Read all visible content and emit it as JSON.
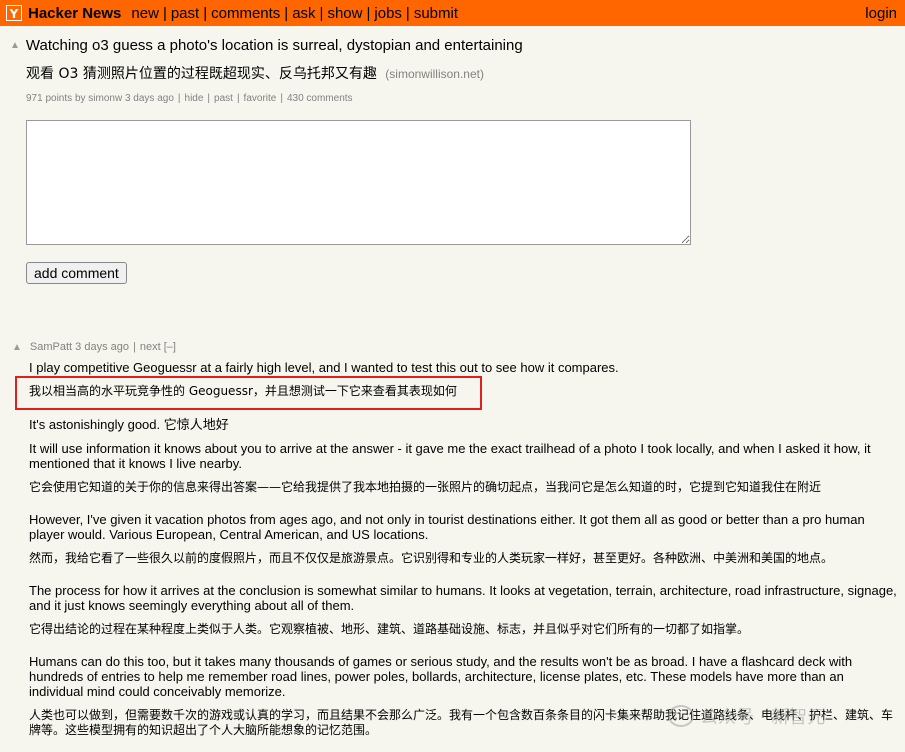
{
  "header": {
    "logo": "Y",
    "site_name": "Hacker News",
    "nav": [
      "new",
      "past",
      "comments",
      "ask",
      "show",
      "jobs",
      "submit"
    ],
    "login": "login"
  },
  "story": {
    "title": "Watching o3 guess a photo's location is surreal, dystopian and entertaining",
    "title_zh": "观看 O3 猜测照片位置的过程既超现实、反乌托邦又有趣",
    "site": "(simonwillison.net)",
    "points": "971 points",
    "by_prefix": "by",
    "author": "simonw",
    "age": "3 days ago",
    "hide": "hide",
    "past": "past",
    "favorite": "favorite",
    "comments": "430 comments"
  },
  "reply": {
    "button_label": "add comment"
  },
  "comment": {
    "author": "SamPatt",
    "age": "3 days ago",
    "next": "next",
    "toggle": "[–]",
    "paragraphs": [
      "I play competitive Geoguessr at a fairly high level, and I wanted to test this out to see how it compares.",
      "我以相当高的水平玩竞争性的 Geoguessr，并且想测试一下它来查看其表现如何",
      "It's astonishingly good.  它惊人地好",
      "It will use information it knows about you to arrive at the answer - it gave me the exact trailhead of a photo I took locally, and when I asked it how, it mentioned that it knows I live nearby.",
      "它会使用它知道的关于你的信息来得出答案——它给我提供了我本地拍摄的一张照片的确切起点，当我问它是怎么知道的时，它提到它知道我住在附近",
      "However, I've given it vacation photos from ages ago, and not only in tourist destinations either. It got them all as good or better than a pro human player would. Various European, Central American, and US locations.",
      "然而，我给它看了一些很久以前的度假照片，而且不仅仅是旅游景点。它识别得和专业的人类玩家一样好，甚至更好。各种欧洲、中美洲和美国的地点。",
      "The process for how it arrives at the conclusion is somewhat similar to humans. It looks at vegetation, terrain, architecture, road infrastructure, signage, and it just knows seemingly everything about all of them.",
      "它得出结论的过程在某种程度上类似于人类。它观察植被、地形、建筑、道路基础设施、标志，并且似乎对它们所有的一切都了如指掌。",
      "Humans can do this too, but it takes many thousands of games or serious study, and the results won't be as broad. I have a flashcard deck with hundreds of entries to help me remember road lines, power poles, bollards, architecture, license plates, etc. These models have more than an individual mind could conceivably memorize.",
      "人类也可以做到，但需要数千次的游戏或认真的学习，而且结果不会那么广泛。我有一个包含数百条条目的闪卡集来帮助我记住道路线条、电线杆、护栏、建筑、车牌等。这些模型拥有的知识超出了个人大脑所能想象的记忆范围。"
    ]
  },
  "watermark": "公众号 · 新智元",
  "colors": {
    "header": "#ff6600",
    "background": "#f6f6ef",
    "subtext": "#828282",
    "highlight": "#e0201c"
  }
}
